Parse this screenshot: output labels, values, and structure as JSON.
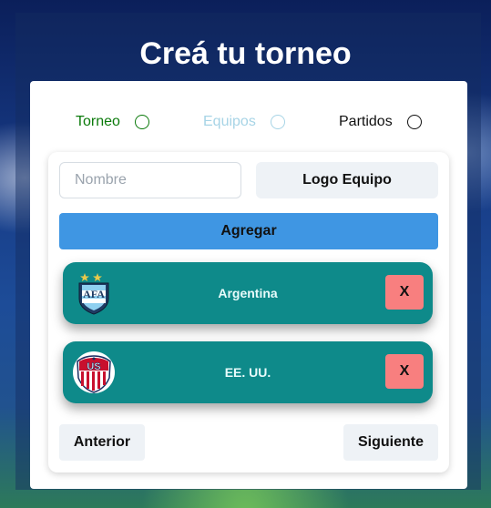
{
  "page": {
    "title": "Creá tu torneo"
  },
  "steps": [
    {
      "label": "Torneo",
      "color": "#0b7a0b"
    },
    {
      "label": "Equipos",
      "color": "#a7d4e6"
    },
    {
      "label": "Partidos",
      "color": "#111111"
    }
  ],
  "form": {
    "name_placeholder": "Nombre",
    "name_value": "",
    "logo_button_label": "Logo Equipo",
    "add_button_label": "Agregar"
  },
  "teams": [
    {
      "name": "Argentina",
      "logo_icon": "afa-crest-icon",
      "remove_label": "X"
    },
    {
      "name": "EE. UU.",
      "logo_icon": "us-soccer-crest-icon",
      "remove_label": "X"
    }
  ],
  "navigation": {
    "prev_label": "Anterior",
    "next_label": "Siguiente"
  },
  "colors": {
    "add_button": "#3f96e3",
    "team_card": "#0e8a8a",
    "remove_button": "#f87f7f"
  }
}
